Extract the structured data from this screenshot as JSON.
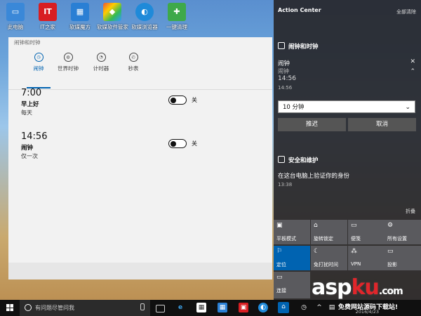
{
  "desktop": {
    "icons": [
      {
        "label": "此电脑",
        "icon": "computer-icon"
      },
      {
        "label": "IT之家",
        "icon": "ithome-icon",
        "glyph": "IT"
      },
      {
        "label": "软媒魔方",
        "icon": "rubik-icon"
      },
      {
        "label": "软媒软件管家",
        "icon": "software-manager-icon"
      },
      {
        "label": "软媒浏览器",
        "icon": "browser-icon"
      },
      {
        "label": "一键清理",
        "icon": "cleaner-icon"
      }
    ]
  },
  "alarms_app": {
    "title": "闹钟和时钟",
    "tabs": [
      {
        "label": "闹钟",
        "icon": "alarm-clock-icon",
        "active": true
      },
      {
        "label": "世界时钟",
        "icon": "globe-icon"
      },
      {
        "label": "计时器",
        "icon": "timer-icon"
      },
      {
        "label": "秒表",
        "icon": "stopwatch-icon"
      }
    ],
    "alarms": [
      {
        "time": "7:00",
        "name": "早上好",
        "repeat": "每天",
        "state_label": "关",
        "on": false
      },
      {
        "time": "14:56",
        "name": "闹钟",
        "repeat": "仅一次",
        "state_label": "关",
        "on": false
      }
    ]
  },
  "action_center": {
    "title": "Action Center",
    "clear_all": "全部清除",
    "alarm_group": {
      "header": "闹钟和时钟",
      "notification": {
        "title": "闹钟",
        "subtitle": "闹钟",
        "time": "14:56",
        "time_small": "14:56",
        "snooze_value": "10 分钟",
        "snooze_label": "推迟",
        "dismiss_label": "取消"
      }
    },
    "security_group": {
      "header": "安全和维护",
      "message": "在这台电脑上验证你的身份",
      "time": "13:38"
    },
    "collapse_label": "折叠",
    "quick_actions": [
      {
        "label": "平板模式",
        "icon": "tablet-mode-icon",
        "glyph": "▣",
        "on": false
      },
      {
        "label": "旋转锁定",
        "icon": "rotation-lock-icon",
        "glyph": "⌂",
        "on": false
      },
      {
        "label": "便笺",
        "icon": "note-icon",
        "glyph": "▭",
        "on": false
      },
      {
        "label": "所有设置",
        "icon": "settings-icon",
        "glyph": "⚙",
        "on": false
      },
      {
        "label": "定位",
        "icon": "location-icon",
        "glyph": "⚐",
        "on": true
      },
      {
        "label": "免打扰时间",
        "icon": "quiet-hours-icon",
        "glyph": "☾",
        "on": false
      },
      {
        "label": "VPN",
        "icon": "vpn-icon",
        "glyph": "⁂",
        "on": false
      },
      {
        "label": "投影",
        "icon": "project-icon",
        "glyph": "▭",
        "on": false
      },
      {
        "label": "连接",
        "icon": "connect-icon",
        "glyph": "▭",
        "on": false
      }
    ]
  },
  "taskbar": {
    "search_placeholder": "有问题尽管问我",
    "date": "2016/4/23"
  },
  "watermark": {
    "brand_a": "asp",
    "brand_b": "ku",
    "brand_c": ".com",
    "tagline": "免费网站源码下载站!"
  }
}
